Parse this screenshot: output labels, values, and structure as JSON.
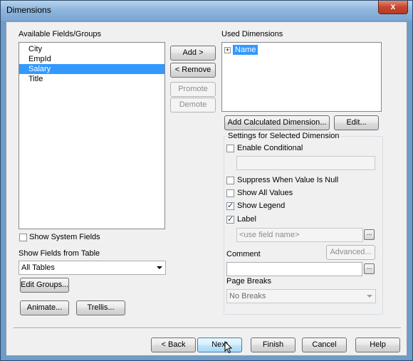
{
  "window": {
    "title": "Dimensions",
    "close_glyph": "x"
  },
  "available": {
    "label": "Available Fields/Groups",
    "items": [
      "City",
      "EmpId",
      "Salary",
      "Title"
    ],
    "selected_index": 2
  },
  "buttons": {
    "add": "Add >",
    "remove": "< Remove",
    "promote": "Promote",
    "demote": "Demote",
    "add_calculated": "Add Calculated Dimension...",
    "edit": "Edit...",
    "edit_groups": "Edit Groups...",
    "animate": "Animate...",
    "trellis": "Trellis...",
    "back": "< Back",
    "next": "Next",
    "finish": "Finish",
    "cancel": "Cancel",
    "help": "Help",
    "advanced": "Advanced...",
    "browse": "..."
  },
  "used": {
    "label": "Used Dimensions",
    "items": [
      {
        "name": "Name",
        "expand_glyph": "+"
      }
    ]
  },
  "show_system_fields": {
    "label": "Show System Fields",
    "checked": false
  },
  "show_fields_from_table": {
    "label": "Show Fields from Table",
    "value": "All Tables"
  },
  "settings": {
    "group_label": "Settings for Selected Dimension",
    "enable_conditional": {
      "label": "Enable Conditional",
      "checked": false
    },
    "conditional_value": "",
    "suppress_null": {
      "label": "Suppress When Value Is Null",
      "checked": false
    },
    "show_all_values": {
      "label": "Show All Values",
      "checked": false
    },
    "show_legend": {
      "label": "Show Legend",
      "checked": true
    },
    "label_check": {
      "label": "Label",
      "checked": true
    },
    "label_placeholder": "<use field name>",
    "comment_label": "Comment",
    "comment_value": "",
    "page_breaks_label": "Page Breaks",
    "page_breaks_value": "No Breaks"
  }
}
